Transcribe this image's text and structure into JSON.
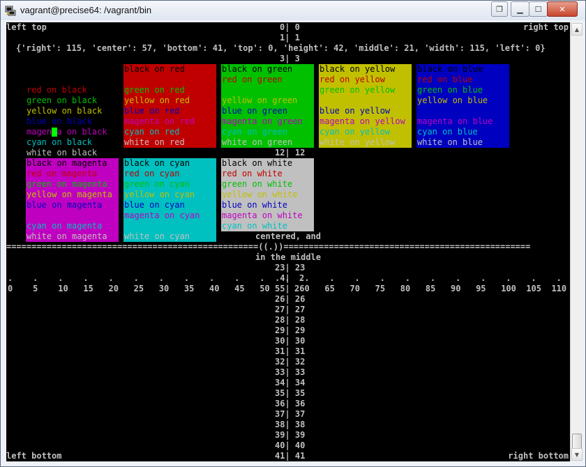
{
  "window": {
    "title": "vagrant@precise64: /vagrant/bin",
    "icons": {
      "app": "putty-icon",
      "restore": "restore-icon",
      "minimize": "minimize-icon",
      "maximize": "maximize-icon",
      "close": "close-icon"
    }
  },
  "terminal": {
    "left_top": "left top",
    "right_top": "right top",
    "left_bottom": "left bottom",
    "right_bottom": "right bottom",
    "dict_line": "{'right': 115, 'center': 57, 'bottom': 41, 'top': 0, 'height': 42, 'middle': 21, 'width': 115, 'left': 0}",
    "centered_1": "centered, and",
    "centered_2": "in the middle",
    "rule_line": "==================================================((.))=================================================",
    "dots_left": ".    .    .    .    .    .    .    .    .    .    .    .",
    "dots_right": "2.    .    .    .    .    .    .    .    .    .    .    .",
    "ruler_left": "0    5    10   15   20   25   30   35   40   45   50",
    "ruler_right": "260   65   70   75   80   85   90   95   100  105  110",
    "rows": {
      "r0": "0| 0",
      "r1": "1| 1",
      "r3": "3| 3",
      "r12": "12| 12",
      "r23": "23| 23",
      "r24": ".4|",
      "r25": "55|",
      "r26": "26| 26",
      "r27": "27| 27",
      "r28": "28| 28",
      "r29": "29| 29",
      "r30": "30| 30",
      "r31": "31| 31",
      "r32": "32| 32",
      "r33": "33| 33",
      "r34": "34| 34",
      "r35": "35| 35",
      "r36": "36| 36",
      "r37": "37| 37",
      "r38": "38| 38",
      "r39": "39| 39",
      "r40": "40| 40",
      "r41": "41| 41"
    },
    "colors": {
      "black": "#000000",
      "red": "#c00000",
      "green": "#00c000",
      "yellow": "#c0c000",
      "blue": "#0000c0",
      "magenta": "#c000c0",
      "cyan": "#00c0c0",
      "white": "#c0c0c0",
      "cursor": "#00ff00"
    },
    "boxes": [
      {
        "bg": "black",
        "lines": [
          {
            "fg": "red",
            "text": "red on black"
          },
          {
            "fg": "green",
            "text": "green on black"
          },
          {
            "fg": "yellow",
            "text": "yellow on black"
          },
          {
            "fg": "blue",
            "text": "blue on black"
          },
          {
            "fg": "magenta",
            "text": "magenta on black"
          },
          {
            "fg": "cyan",
            "text": "cyan on black"
          },
          {
            "fg": "white",
            "text": "white on black"
          }
        ]
      },
      {
        "bg": "red",
        "lines": [
          {
            "fg": "black",
            "text": "black on red"
          },
          {
            "fg": "red",
            "text": ""
          },
          {
            "fg": "green",
            "text": "green on red"
          },
          {
            "fg": "yellow",
            "text": "yellow on red"
          },
          {
            "fg": "blue",
            "text": "blue on red"
          },
          {
            "fg": "magenta",
            "text": "magenta on red"
          },
          {
            "fg": "cyan",
            "text": "cyan on red"
          },
          {
            "fg": "white",
            "text": "white on red"
          }
        ]
      },
      {
        "bg": "green",
        "lines": [
          {
            "fg": "black",
            "text": "black on green"
          },
          {
            "fg": "red",
            "text": "red on green"
          },
          {
            "fg": "green",
            "text": ""
          },
          {
            "fg": "yellow",
            "text": "yellow on green"
          },
          {
            "fg": "blue",
            "text": "blue on green"
          },
          {
            "fg": "magenta",
            "text": "magenta on green"
          },
          {
            "fg": "cyan",
            "text": "cyan on green"
          },
          {
            "fg": "white",
            "text": "white on green"
          }
        ]
      },
      {
        "bg": "yellow",
        "lines": [
          {
            "fg": "black",
            "text": "black on yellow"
          },
          {
            "fg": "red",
            "text": "red on yellow"
          },
          {
            "fg": "green",
            "text": "green on yellow"
          },
          {
            "fg": "yellow",
            "text": ""
          },
          {
            "fg": "blue",
            "text": "blue on yellow"
          },
          {
            "fg": "magenta",
            "text": "magenta on yellow"
          },
          {
            "fg": "cyan",
            "text": "cyan on yellow"
          },
          {
            "fg": "white",
            "text": "white on yellow"
          }
        ]
      },
      {
        "bg": "blue",
        "lines": [
          {
            "fg": "black",
            "text": "black on blue"
          },
          {
            "fg": "red",
            "text": "red on blue"
          },
          {
            "fg": "green",
            "text": "green on blue"
          },
          {
            "fg": "yellow",
            "text": "yellow on blue"
          },
          {
            "fg": "blue",
            "text": ""
          },
          {
            "fg": "magenta",
            "text": "magenta on blue"
          },
          {
            "fg": "cyan",
            "text": "cyan on blue"
          },
          {
            "fg": "white",
            "text": "white on blue"
          }
        ]
      },
      {
        "bg": "magenta",
        "lines": [
          {
            "fg": "black",
            "text": "black on magenta"
          },
          {
            "fg": "red",
            "text": "red on magenta"
          },
          {
            "fg": "green",
            "text": "green on magenta"
          },
          {
            "fg": "yellow",
            "text": "yellow on magenta"
          },
          {
            "fg": "blue",
            "text": "blue on magenta"
          },
          {
            "fg": "magenta",
            "text": ""
          },
          {
            "fg": "cyan",
            "text": "cyan on magenta"
          },
          {
            "fg": "white",
            "text": "white on magenta"
          }
        ]
      },
      {
        "bg": "cyan",
        "lines": [
          {
            "fg": "black",
            "text": "black on cyan"
          },
          {
            "fg": "red",
            "text": "red on cyan"
          },
          {
            "fg": "green",
            "text": "green on cyan"
          },
          {
            "fg": "yellow",
            "text": "yellow on cyan"
          },
          {
            "fg": "blue",
            "text": "blue on cyan"
          },
          {
            "fg": "magenta",
            "text": "magenta on cyan"
          },
          {
            "fg": "cyan",
            "text": ""
          },
          {
            "fg": "white",
            "text": "white on cyan"
          }
        ]
      },
      {
        "bg": "white",
        "lines": [
          {
            "fg": "black",
            "text": "black on white"
          },
          {
            "fg": "red",
            "text": "red on white"
          },
          {
            "fg": "green",
            "text": "green on white"
          },
          {
            "fg": "yellow",
            "text": "yellow on white"
          },
          {
            "fg": "blue",
            "text": "blue on white"
          },
          {
            "fg": "magenta",
            "text": "magenta on white"
          },
          {
            "fg": "cyan",
            "text": "cyan on white"
          }
        ]
      }
    ]
  }
}
